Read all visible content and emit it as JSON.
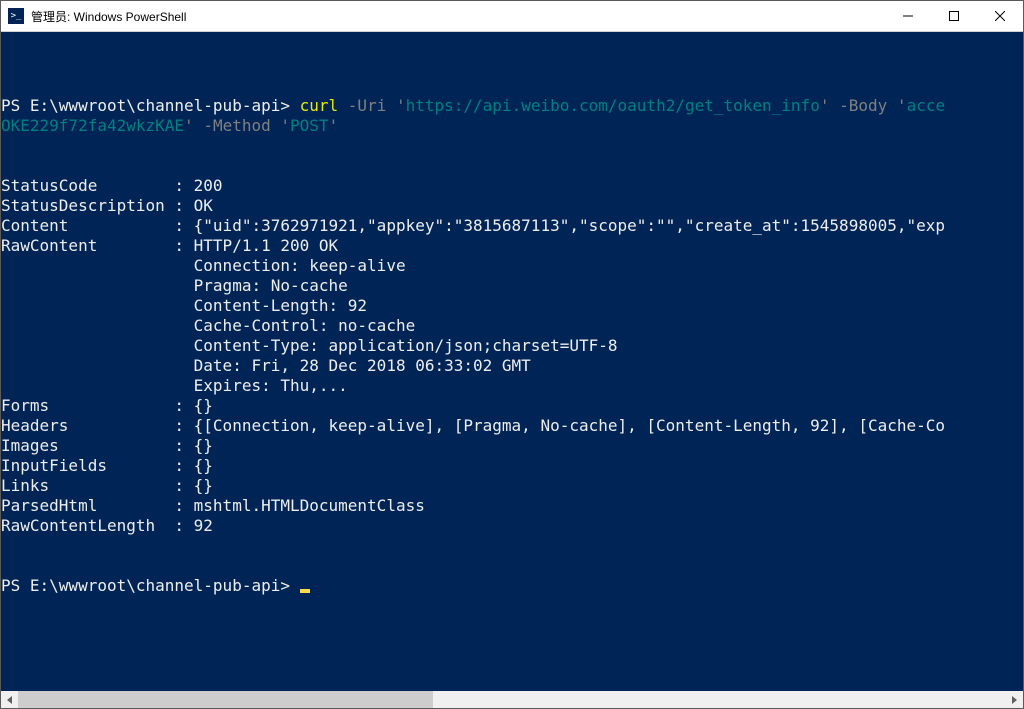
{
  "window": {
    "title": "管理员: Windows PowerShell"
  },
  "cmd": {
    "prompt1": "PS E:\\wwwroot\\channel-pub-api> ",
    "curl": "curl",
    "sp1": " ",
    "flag_uri": "-Uri",
    "sp2": " ",
    "q1a": "'",
    "url": "https://api.weibo.com/oauth2/get_token_info",
    "q1b": "'",
    "sp3": " ",
    "flag_body": "-Body",
    "sp4": " ",
    "q2a": "'",
    "body_tail": "acce",
    "line2_body": "OKE229f72fa42wkzKAE",
    "q2b": "'",
    "sp5": " ",
    "flag_method": "-Method",
    "sp6": " ",
    "q3a": "'",
    "method": "POST",
    "q3b": "'"
  },
  "output": {
    "status_code_label": "StatusCode        : ",
    "status_code_value": "200",
    "status_desc_label": "StatusDescription : ",
    "status_desc_value": "OK",
    "content_label": "Content           : ",
    "content_value": "{\"uid\":3762971921,\"appkey\":\"3815687113\",\"scope\":\"\",\"create_at\":1545898005,\"exp",
    "rawcontent_label": "RawContent        : ",
    "rawcontent_l0": "HTTP/1.1 200 OK",
    "raw_indent": "                    ",
    "rawcontent_l1": "Connection: keep-alive",
    "rawcontent_l2": "Pragma: No-cache",
    "rawcontent_l3": "Content-Length: 92",
    "rawcontent_l4": "Cache-Control: no-cache",
    "rawcontent_l5": "Content-Type: application/json;charset=UTF-8",
    "rawcontent_l6": "Date: Fri, 28 Dec 2018 06:33:02 GMT",
    "rawcontent_l7": "Expires: Thu,...",
    "forms_label": "Forms             : ",
    "forms_value": "{}",
    "headers_label": "Headers           : ",
    "headers_value": "{[Connection, keep-alive], [Pragma, No-cache], [Content-Length, 92], [Cache-Co",
    "images_label": "Images            : ",
    "images_value": "{}",
    "inputfields_label": "InputFields       : ",
    "inputfields_value": "{}",
    "links_label": "Links             : ",
    "links_value": "{}",
    "parsedhtml_label": "ParsedHtml        : ",
    "parsedhtml_value": "mshtml.HTMLDocumentClass",
    "rawlen_label": "RawContentLength  : ",
    "rawlen_value": "92"
  },
  "prompt2": "PS E:\\wwwroot\\channel-pub-api> "
}
